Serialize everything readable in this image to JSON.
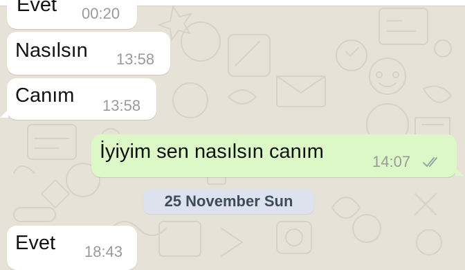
{
  "messages": [
    {
      "direction": "incoming",
      "text": "Evet",
      "time": "00:20"
    },
    {
      "direction": "incoming",
      "text": "Nasılsın",
      "time": "13:58"
    },
    {
      "direction": "incoming",
      "text": "Canım",
      "time": "13:58"
    },
    {
      "direction": "outgoing",
      "text": "İyiyim sen nasılsın canım",
      "time": "14:07",
      "status_icon": "double-check-icon"
    },
    {
      "direction": "incoming",
      "text": "Evet",
      "time": "18:43"
    }
  ],
  "date_separator": {
    "label": "25 November Sun"
  },
  "colors": {
    "wallpaper": "#e7e2d8",
    "incoming_bubble": "#ffffff",
    "outgoing_bubble": "#dcf8c6",
    "date_chip": "#dde3ee",
    "timestamp": "#9a9a9a"
  }
}
